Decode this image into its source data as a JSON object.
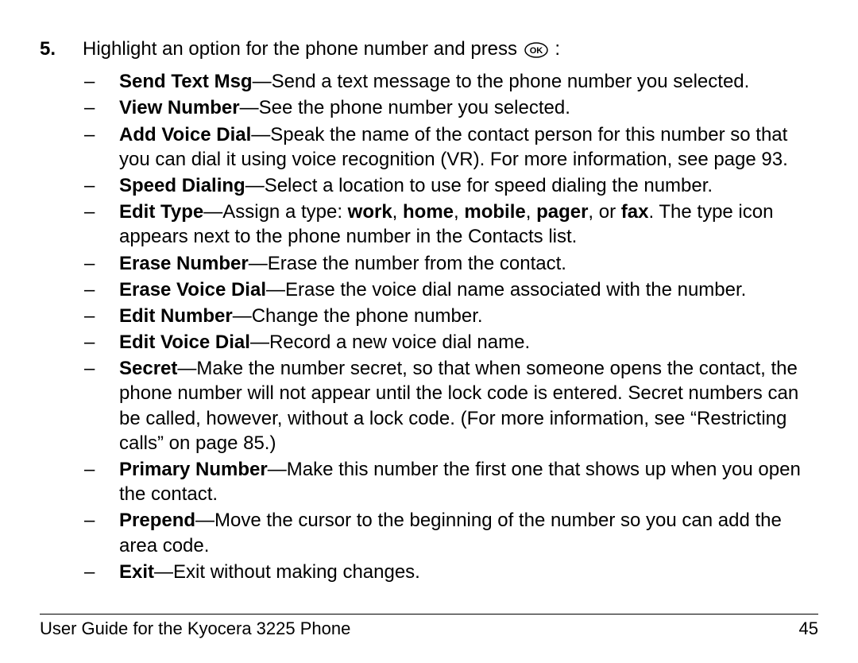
{
  "step": {
    "number": "5.",
    "lead_in": "Highlight an option for the phone number and press ",
    "colon": " :"
  },
  "items": [
    {
      "label": "Send Text Msg",
      "desc": "—Send a text message to the phone number you selected."
    },
    {
      "label": "View Number",
      "desc": "—See the phone number you selected."
    },
    {
      "label": "Add Voice Dial",
      "desc": "—Speak the name of the contact person for this number so that you can dial it using voice recognition (VR). For more information, see page 93."
    },
    {
      "label": "Speed Dialing",
      "desc": "—Select a location to use for speed dialing the number."
    },
    {
      "label": "Edit Type",
      "desc_pre": "—Assign a type: ",
      "types": [
        "work",
        "home",
        "mobile",
        "pager",
        "fax"
      ],
      "or_word": "or",
      "desc_post": ". The type icon appears next to the phone number in the Contacts list."
    },
    {
      "label": "Erase Number",
      "desc": "—Erase the number from the contact."
    },
    {
      "label": "Erase Voice Dial",
      "desc": "—Erase the voice dial name associated with the number."
    },
    {
      "label": "Edit Number",
      "desc": "—Change the phone number."
    },
    {
      "label": "Edit Voice Dial",
      "desc": "—Record a new voice dial name."
    },
    {
      "label": "Secret",
      "desc": "—Make the number secret, so that when someone opens the contact, the phone number will not appear until the lock code is entered. Secret numbers can be called, however, without a lock code. (For more information, see “Restricting calls” on page 85.)"
    },
    {
      "label": "Primary Number",
      "desc": "—Make this number the first one that shows up when you open the contact."
    },
    {
      "label": "Prepend",
      "desc": "—Move the cursor to the beginning of the number so you can add the area code."
    },
    {
      "label": "Exit",
      "desc": "—Exit without making changes."
    }
  ],
  "dash": "–",
  "footer": {
    "left": "User Guide for the Kyocera 3225 Phone",
    "right": "45"
  }
}
